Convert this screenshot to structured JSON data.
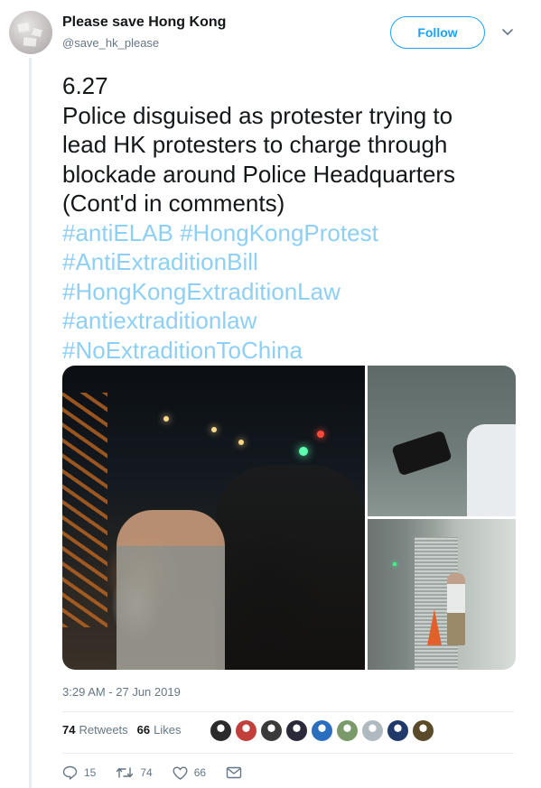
{
  "author": {
    "display_name": "Please save Hong Kong",
    "handle": "@save_hk_please"
  },
  "follow_button_label": "Follow",
  "tweet": {
    "lines": [
      "6.27",
      "Police disguised as protester trying to",
      "lead HK protesters to charge through",
      "blockade around Police Headquarters",
      "(Cont'd in comments)"
    ],
    "hashtag_lines": [
      "#antiELAB #HongKongProtest",
      "#AntiExtraditionBill",
      "#HongKongExtraditionLaw",
      "#antiextraditionlaw",
      "#NoExtraditionToChina"
    ]
  },
  "timestamp": "3:29 AM - 27 Jun 2019",
  "stats": {
    "retweets_count": "74",
    "retweets_label": "Retweets",
    "likes_count": "66",
    "likes_label": "Likes"
  },
  "liker_avatar_colors": [
    "#2b2b2b",
    "#c2403a",
    "#3a3a3a",
    "#2a2a3a",
    "#2a6fbf",
    "#7a9a6a",
    "#b0b8c0",
    "#1f3a6a",
    "#5a4a2a"
  ],
  "actions": {
    "reply_count": "15",
    "retweet_count": "74",
    "like_count": "66"
  },
  "icons": {
    "reply": "reply-icon",
    "retweet": "retweet-icon",
    "like": "heart-icon",
    "message": "envelope-icon",
    "caret": "chevron-down-icon"
  },
  "colors": {
    "accent": "#1da1f2",
    "hashtag": "#8dcff5",
    "muted": "#657786",
    "text": "#14171a"
  }
}
